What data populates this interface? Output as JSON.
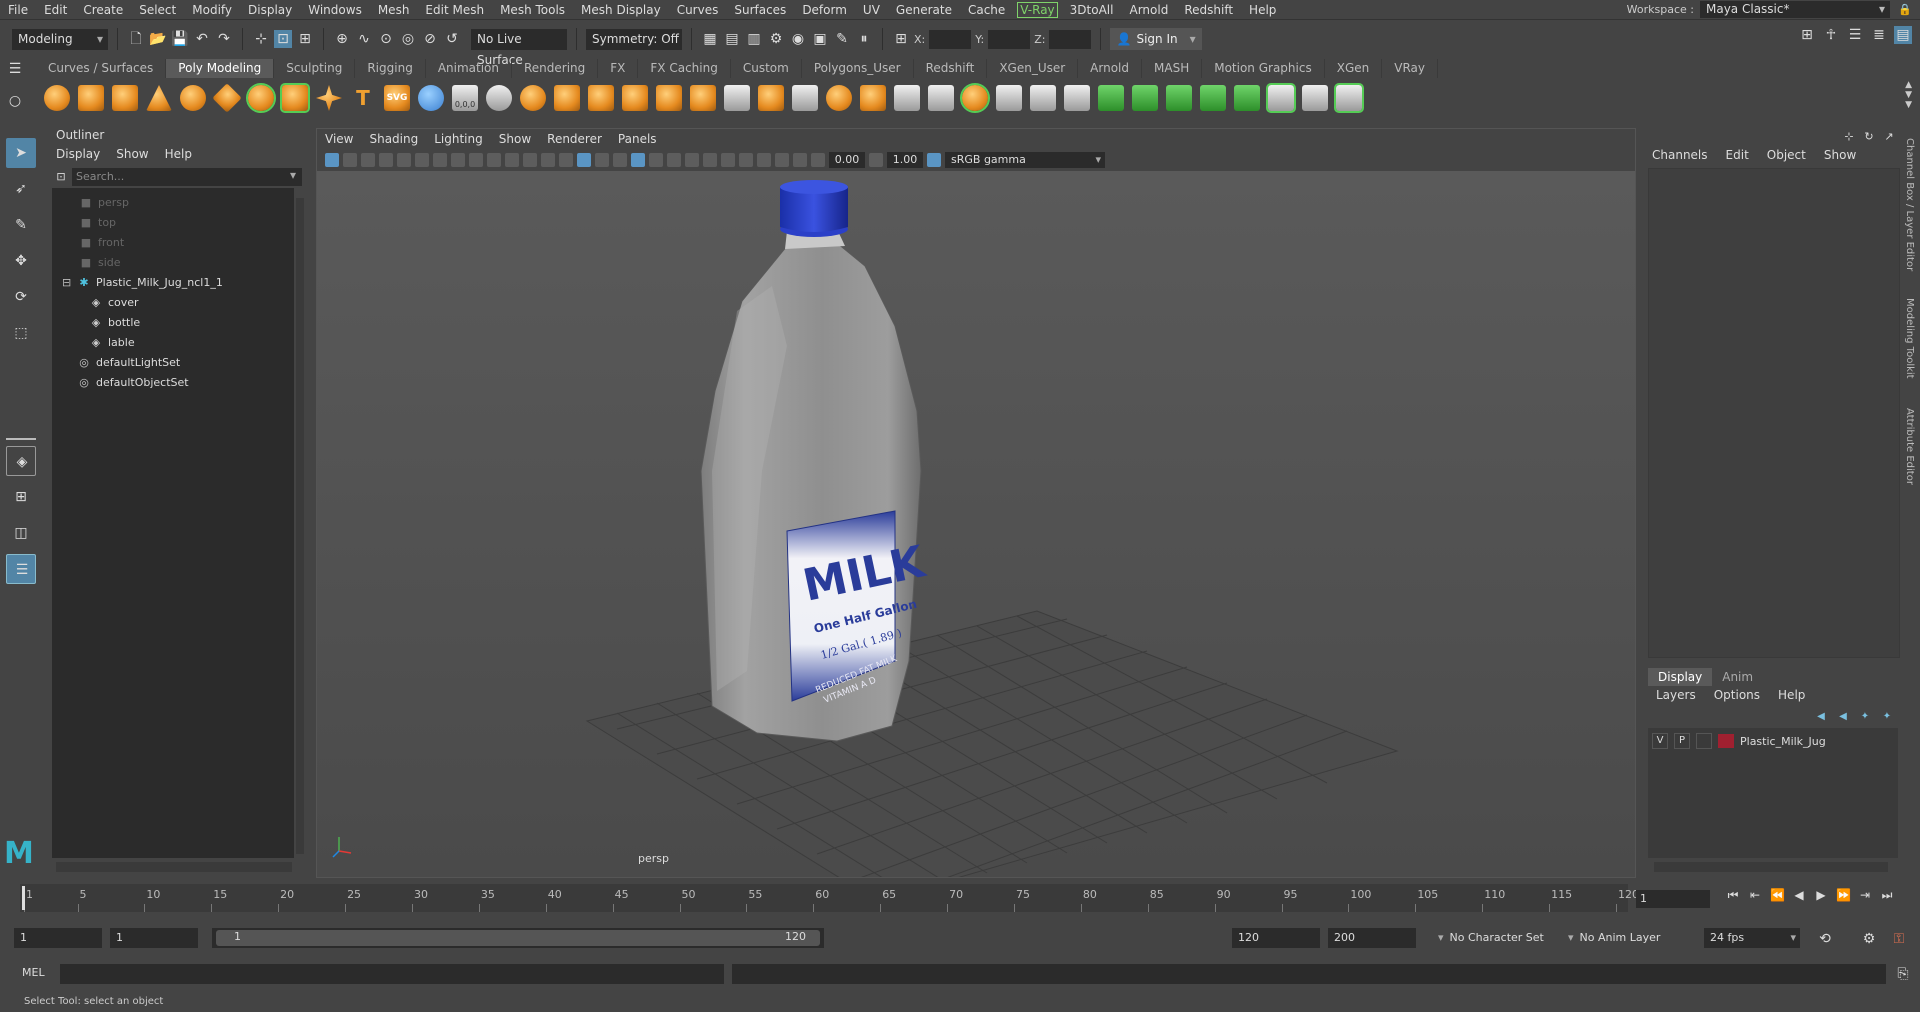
{
  "menubar": {
    "items": [
      "File",
      "Edit",
      "Create",
      "Select",
      "Modify",
      "Display",
      "Windows",
      "Mesh",
      "Edit Mesh",
      "Mesh Tools",
      "Mesh Display",
      "Curves",
      "Surfaces",
      "Deform",
      "UV",
      "Generate",
      "Cache",
      "V-Ray",
      "3DtoAll",
      "Arnold",
      "Redshift",
      "Help"
    ],
    "workspace_label": "Workspace :",
    "workspace_value": "Maya Classic*"
  },
  "statusline": {
    "mode": "Modeling",
    "live_surface": "No Live Surface",
    "symmetry": "Symmetry: Off",
    "x_label": "X:",
    "y_label": "Y:",
    "z_label": "Z:",
    "sign_in": "Sign In"
  },
  "shelf": {
    "tabs": [
      "Curves / Surfaces",
      "Poly Modeling",
      "Sculpting",
      "Rigging",
      "Animation",
      "Rendering",
      "FX",
      "FX Caching",
      "Custom",
      "Polygons_User",
      "Redshift",
      "XGen_User",
      "Arnold",
      "MASH",
      "Motion Graphics",
      "XGen",
      "VRay"
    ],
    "active_tab": "Poly Modeling",
    "text_icon": "T",
    "svg_icon": "SVG",
    "coord_icon": "0,0,0"
  },
  "outliner": {
    "title": "Outliner",
    "menu": [
      "Display",
      "Show",
      "Help"
    ],
    "search_placeholder": "Search...",
    "rows": [
      {
        "label": "persp",
        "type": "camera",
        "dim": true
      },
      {
        "label": "top",
        "type": "camera",
        "dim": true
      },
      {
        "label": "front",
        "type": "camera",
        "dim": true
      },
      {
        "label": "side",
        "type": "camera",
        "dim": true
      },
      {
        "label": "Plastic_Milk_Jug_ncl1_1",
        "type": "group",
        "dim": false
      },
      {
        "label": "cover",
        "type": "mesh",
        "dim": false
      },
      {
        "label": "bottle",
        "type": "mesh",
        "dim": false
      },
      {
        "label": "lable",
        "type": "mesh",
        "dim": false
      },
      {
        "label": "defaultLightSet",
        "type": "set",
        "dim": false
      },
      {
        "label": "defaultObjectSet",
        "type": "set",
        "dim": false
      }
    ]
  },
  "viewport": {
    "menu": [
      "View",
      "Shading",
      "Lighting",
      "Show",
      "Renderer",
      "Panels"
    ],
    "exposure": "0.00",
    "gamma": "1.00",
    "color_space": "sRGB gamma",
    "camera_label": "persp",
    "label_text": {
      "title": "MILK",
      "subtitle": "One Half Gallon",
      "volume": "1/2 Gal.( 1.89 )",
      "line1": "REDUCED FAT MILK",
      "line2": "VITAMIN A D"
    }
  },
  "channelbox": {
    "menu": [
      "Channels",
      "Edit",
      "Object",
      "Show"
    ],
    "side_tabs": [
      "Channel Box / Layer Editor",
      "Modeling Toolkit",
      "Attribute Editor"
    ]
  },
  "layereditor": {
    "tabs": [
      "Display",
      "Anim"
    ],
    "active_tab": "Display",
    "menu": [
      "Layers",
      "Options",
      "Help"
    ],
    "layer": {
      "v": "V",
      "p": "P",
      "name": "Plastic_Milk_Jug",
      "color": "#a02030"
    }
  },
  "timeline": {
    "ticks": [
      "1",
      "5",
      "10",
      "15",
      "20",
      "25",
      "30",
      "35",
      "40",
      "45",
      "50",
      "55",
      "60",
      "65",
      "70",
      "75",
      "80",
      "85",
      "90",
      "95",
      "100",
      "105",
      "110",
      "115",
      "120"
    ],
    "current_frame": "1"
  },
  "range": {
    "start": "1",
    "playback_start": "1",
    "slider_start": "1",
    "slider_end": "120",
    "playback_end": "120",
    "end": "200",
    "character_set": "No Character Set",
    "anim_layer": "No Anim Layer",
    "fps": "24 fps"
  },
  "cmdline": {
    "label": "MEL"
  },
  "helpline": {
    "text": "Select Tool: select an object"
  }
}
